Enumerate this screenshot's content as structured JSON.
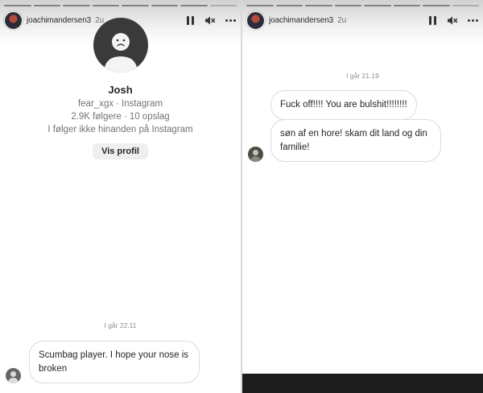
{
  "stories": [
    {
      "username": "joachimandersen3",
      "time_ago": "2u",
      "profile": {
        "name": "Josh",
        "handle": "fear_xgx",
        "platform": "Instagram",
        "followers": "2.9K følgere",
        "posts": "10 opslag",
        "relation": "I følger ikke hinanden på Instagram",
        "button_label": "Vis profil"
      },
      "timestamp": "I går 22.11",
      "messages": [
        {
          "text_line1": "Scumbag player. I hope your nose is",
          "text_line2": "broken"
        }
      ]
    },
    {
      "username": "joachimandersen3",
      "time_ago": "2u",
      "timestamp": "I går 21.19",
      "messages": [
        {
          "text_line1": "Fuck off!!!! You are bulshit!!!!!!!!"
        },
        {
          "text_line1": "søn af en hore!  skam dit land og din",
          "text_line2": "familie!"
        }
      ]
    }
  ],
  "icons": [
    "pause-icon",
    "mute-icon",
    "more-icon"
  ],
  "colors": {
    "bubble_border": "#dbdbdb",
    "secondary_text": "#737373",
    "button_bg": "#efefef",
    "bottom_bar": "#1c1c1c"
  }
}
